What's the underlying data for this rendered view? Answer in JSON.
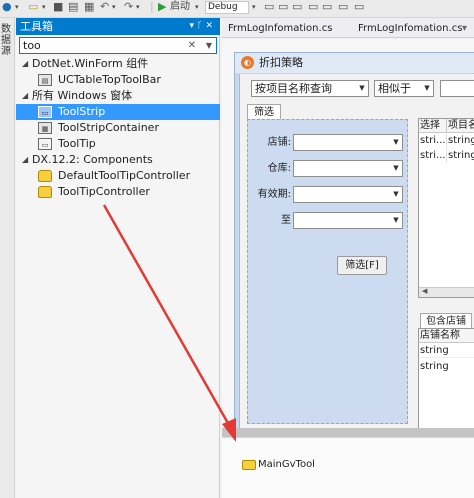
{
  "toolbar": {
    "run_label": "启动",
    "config_value": "Debug",
    "icons": [
      "dropdown-arrow-icon",
      "open-folder-icon",
      "save-icon",
      "save-all-icon",
      "undo-icon",
      "redo-icon",
      "start-icon",
      "config-dropdown-icon"
    ]
  },
  "left_strip": {
    "label": "数据源"
  },
  "toolbox": {
    "title": "工具箱",
    "title_icons": [
      "dropdown-icon",
      "pin-icon",
      "close-icon"
    ],
    "search_value": "too",
    "groups": [
      {
        "label": "DotNet.WinForm 组件",
        "expanded": true,
        "items": [
          {
            "label": "UCTableTopToolBar",
            "icon": "component-icon",
            "selected": false
          }
        ]
      },
      {
        "label": "所有 Windows 窗体",
        "expanded": true,
        "items": [
          {
            "label": "ToolStrip",
            "icon": "toolstrip-icon",
            "selected": true
          },
          {
            "label": "ToolStripContainer",
            "icon": "toolstripcontainer-icon",
            "selected": false
          },
          {
            "label": "ToolTip",
            "icon": "tooltip-icon",
            "selected": false
          }
        ]
      },
      {
        "label": "DX.12.2: Components",
        "expanded": true,
        "items": [
          {
            "label": "DefaultToolTipController",
            "icon": "tooltip-controller-icon",
            "selected": false
          },
          {
            "label": "ToolTipController",
            "icon": "tooltip-controller-icon",
            "selected": false
          }
        ]
      }
    ]
  },
  "tabs": [
    {
      "label": "FrmLogInfomation.cs",
      "active": false
    },
    {
      "label": "FrmLogInfomation.cs",
      "active": false
    }
  ],
  "form": {
    "title": "折扣策略",
    "query_mode": "按项目名称查询",
    "match_mode": "相似于",
    "filter_tab": "筛选",
    "fields": [
      {
        "label": "店铺:"
      },
      {
        "label": "仓库:"
      },
      {
        "label": "有效期:"
      },
      {
        "label": "至"
      }
    ],
    "filter_button": "筛选[F]",
    "grid1": {
      "columns": [
        "选择",
        "项目名"
      ],
      "rows": [
        [
          "stri...",
          "string"
        ],
        [
          "stri...",
          "string"
        ]
      ]
    },
    "bottom_tab": "包含店铺",
    "grid2": {
      "columns": [
        "店铺名称"
      ],
      "rows": [
        [
          "string"
        ],
        [
          "string"
        ]
      ]
    }
  },
  "component_tray": {
    "items": [
      {
        "label": "MainGvTool",
        "icon": "component-folder-icon"
      }
    ]
  },
  "colors": {
    "accent": "#007acc",
    "selection": "#3399ff",
    "form_border": "#9bb3d4",
    "filter_panel": "#cddbf0",
    "arrow": "#e53935"
  }
}
